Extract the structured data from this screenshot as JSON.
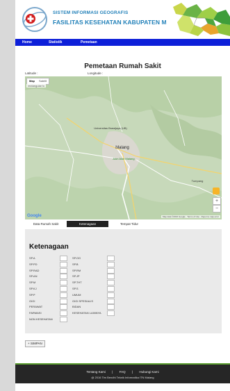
{
  "header": {
    "title_line1": "SISTEM INFORMASI GEOGRAFIS",
    "title_line2": "FASILITAS KESEHATAN KABUPATEN MALANG"
  },
  "nav": {
    "items": [
      "Home",
      "Statistik",
      "Pemetaan"
    ]
  },
  "main": {
    "section_title": "Pemetaan Rumah Sakit",
    "latitude_label": "Latitude :",
    "longitude_label": "Longitude :"
  },
  "map": {
    "type_map": "Map",
    "type_satellite": "Satelit",
    "type_sub": "rectangular tc",
    "labels": {
      "universitas": "Universitas Brawijaya (UB)",
      "malang": "Malang",
      "alun": "Alun Alun Malang",
      "tumpang": "Tumpang"
    },
    "google": "Google",
    "footer_text": "Map data ©2016 Google · Terms of Use · Report a map error"
  },
  "tabs": [
    "Data Rumah Sakit",
    "Ketenagaan",
    "Tempat Tidur"
  ],
  "panel": {
    "title": "Ketenagaan",
    "col1": [
      "SP.A",
      "SP.PD",
      "SP.RAD",
      "SP.AN",
      "SP.M",
      "SP.KJ",
      "SP.P",
      "GIGI",
      "PERAWAT",
      "FARMASI",
      "NON KESEHATAN"
    ],
    "col2": [
      "SP.OG",
      "SP.B",
      "SP.RM",
      "SP.JP",
      "SP.THT",
      "SP.S",
      "UMUM",
      "GIGI SPESIALIS",
      "BIDAN",
      "KESEHATAN LAINNYA"
    ]
  },
  "save_label": "+ SIMPAN",
  "footer": {
    "links": [
      "Tentang Kami",
      "|",
      "FAQ",
      "|",
      "Hubungi Kami"
    ],
    "copyright": "@ 2016 Tim Bendhi Teknik Informatika ITN Malang"
  },
  "colors": {
    "nav": "#0d1fd9",
    "title": "#1f7fb8",
    "footer": "#262626",
    "footer_accent": "#5a9e2f"
  }
}
